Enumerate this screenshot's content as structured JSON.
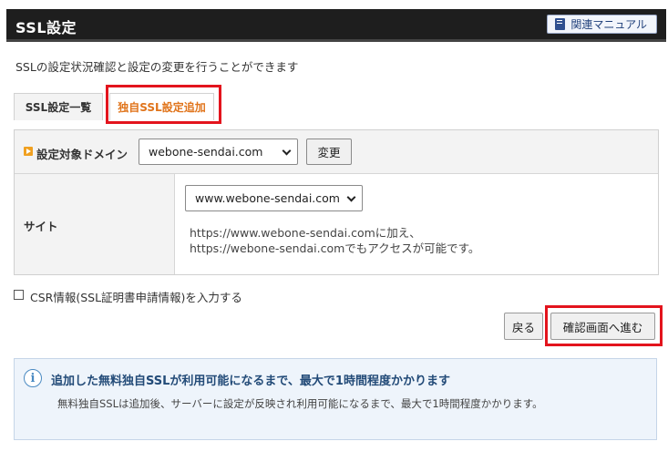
{
  "header": {
    "title": "SSL設定",
    "manual_label": "関連マニュアル"
  },
  "description": "SSLの設定状況確認と設定の変更を行うことができます",
  "tabs": [
    {
      "label": "SSL設定一覧",
      "active": false
    },
    {
      "label": "独自SSL設定追加",
      "active": true
    }
  ],
  "form": {
    "domain_label": "設定対象ドメイン",
    "domain_value": "webone-sendai.com",
    "change_label": "変更",
    "site_label": "サイト",
    "site_value": "www.webone-sendai.com",
    "note_line1": "https://www.webone-sendai.comに加え、",
    "note_line2": "https://webone-sendai.comでもアクセスが可能です。"
  },
  "csr": {
    "label": "CSR情報(SSL証明書申請情報)を入力する",
    "checked": false
  },
  "buttons": {
    "back_label": "戻る",
    "confirm_label": "確認画面へ進む"
  },
  "info": {
    "icon": "i",
    "title": "追加した無料独自SSLが利用可能になるまで、最大で1時間程度かかります",
    "body": "無料独自SSLは追加後、サーバーに設定が反映され利用可能になるまで、最大で1時間程度かかります。"
  },
  "colors": {
    "highlight": "#e3141d",
    "active_tab": "#e0741b",
    "header_bg": "#1e1e1e",
    "info_bg": "#eef4fb"
  }
}
